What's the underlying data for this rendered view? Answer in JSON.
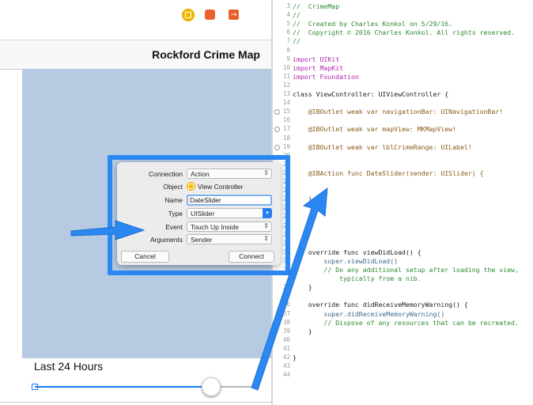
{
  "storyboard": {
    "nav_title": "Rockford Crime Map",
    "range_label": "Last 24 Hours",
    "slider": {
      "value": 0.97
    },
    "dock_icons": [
      "view-controller-icon",
      "first-responder-icon",
      "exit-icon"
    ]
  },
  "editor": {
    "lines": [
      {
        "num": "3",
        "cls": "c-cmt",
        "text": "//  CrimeMap"
      },
      {
        "num": "4",
        "cls": "c-cmt",
        "text": "//"
      },
      {
        "num": "5",
        "cls": "c-cmt",
        "text": "//  Created by Charles Konkol on 5/29/16."
      },
      {
        "num": "6",
        "cls": "c-cmt",
        "text": "//  Copyright © 2016 Charles Konkol. All rights reserved."
      },
      {
        "num": "7",
        "cls": "c-cmt",
        "text": "//"
      },
      {
        "num": "8",
        "cls": "",
        "text": ""
      },
      {
        "num": "9",
        "cls": "c-kw",
        "text": "import UIKit"
      },
      {
        "num": "10",
        "cls": "c-kw",
        "text": "import MapKit"
      },
      {
        "num": "11",
        "cls": "c-kw",
        "text": "import Foundation"
      },
      {
        "num": "12",
        "cls": "",
        "text": ""
      },
      {
        "num": "13",
        "cls": "",
        "text": "class ViewController: UIViewController {"
      },
      {
        "num": "14",
        "cls": "",
        "text": ""
      },
      {
        "num": "15",
        "cls": "c-attr",
        "text": "    @IBOutlet weak var navigationBar: UINavigationBar!",
        "conn": true
      },
      {
        "num": "16",
        "cls": "",
        "text": ""
      },
      {
        "num": "17",
        "cls": "c-attr",
        "text": "    @IBOutlet weak var mapView: MKMapView!",
        "conn": true
      },
      {
        "num": "18",
        "cls": "",
        "text": ""
      },
      {
        "num": "19",
        "cls": "c-attr",
        "text": "    @IBOutlet weak var lblCrimeRange: UILabel!",
        "conn": true
      },
      {
        "num": "20",
        "cls": "",
        "text": ""
      },
      {
        "num": "21",
        "cls": "",
        "text": ""
      },
      {
        "num": "22",
        "cls": "c-attr",
        "text": "    @IBAction func DateSlider(sender: UISlider) {"
      },
      {
        "num": "23",
        "cls": "",
        "text": ""
      },
      {
        "num": "24",
        "cls": "",
        "text": ""
      },
      {
        "num": "25",
        "cls": "",
        "text": "    }"
      },
      {
        "num": "26",
        "cls": "",
        "text": ""
      },
      {
        "num": "27",
        "cls": "",
        "text": ""
      },
      {
        "num": "28",
        "cls": "",
        "text": ""
      },
      {
        "num": "29",
        "cls": "",
        "text": ""
      },
      {
        "num": "30",
        "cls": "",
        "text": ""
      },
      {
        "num": "31",
        "cls": "",
        "text": "    override func viewDidLoad() {"
      },
      {
        "num": "32",
        "cls": "c-mth",
        "text": "        super.viewDidLoad()"
      },
      {
        "num": "33",
        "cls": "c-cmt",
        "text": "        // Do any additional setup after loading the view,"
      },
      {
        "num": "",
        "cls": "c-cmt",
        "text": "            typically from a nib."
      },
      {
        "num": "34",
        "cls": "",
        "text": "    }"
      },
      {
        "num": "35",
        "cls": "",
        "text": ""
      },
      {
        "num": "36",
        "cls": "",
        "text": "    override func didReceiveMemoryWarning() {"
      },
      {
        "num": "37",
        "cls": "c-mth",
        "text": "        super.didReceiveMemoryWarning()"
      },
      {
        "num": "38",
        "cls": "c-cmt",
        "text": "        // Dispose of any resources that can be recreated."
      },
      {
        "num": "39",
        "cls": "",
        "text": "    }"
      },
      {
        "num": "40",
        "cls": "",
        "text": ""
      },
      {
        "num": "41",
        "cls": "",
        "text": ""
      },
      {
        "num": "42",
        "cls": "",
        "text": "}"
      },
      {
        "num": "43",
        "cls": "",
        "text": ""
      },
      {
        "num": "44",
        "cls": "",
        "text": ""
      }
    ]
  },
  "popover": {
    "connection": {
      "label": "Connection",
      "value": "Action"
    },
    "object": {
      "label": "Object",
      "value": "View Controller"
    },
    "name": {
      "label": "Name",
      "value": "DateSlider"
    },
    "type": {
      "label": "Type",
      "value": "UISlider"
    },
    "event": {
      "label": "Event",
      "value": "Touch Up Inside"
    },
    "arguments": {
      "label": "Arguments",
      "value": "Sender"
    },
    "cancel_label": "Cancel",
    "connect_label": "Connect"
  },
  "colors": {
    "accent": "#2b88f2",
    "map": "#b6cbe2",
    "slider": "#1a7cf5"
  }
}
